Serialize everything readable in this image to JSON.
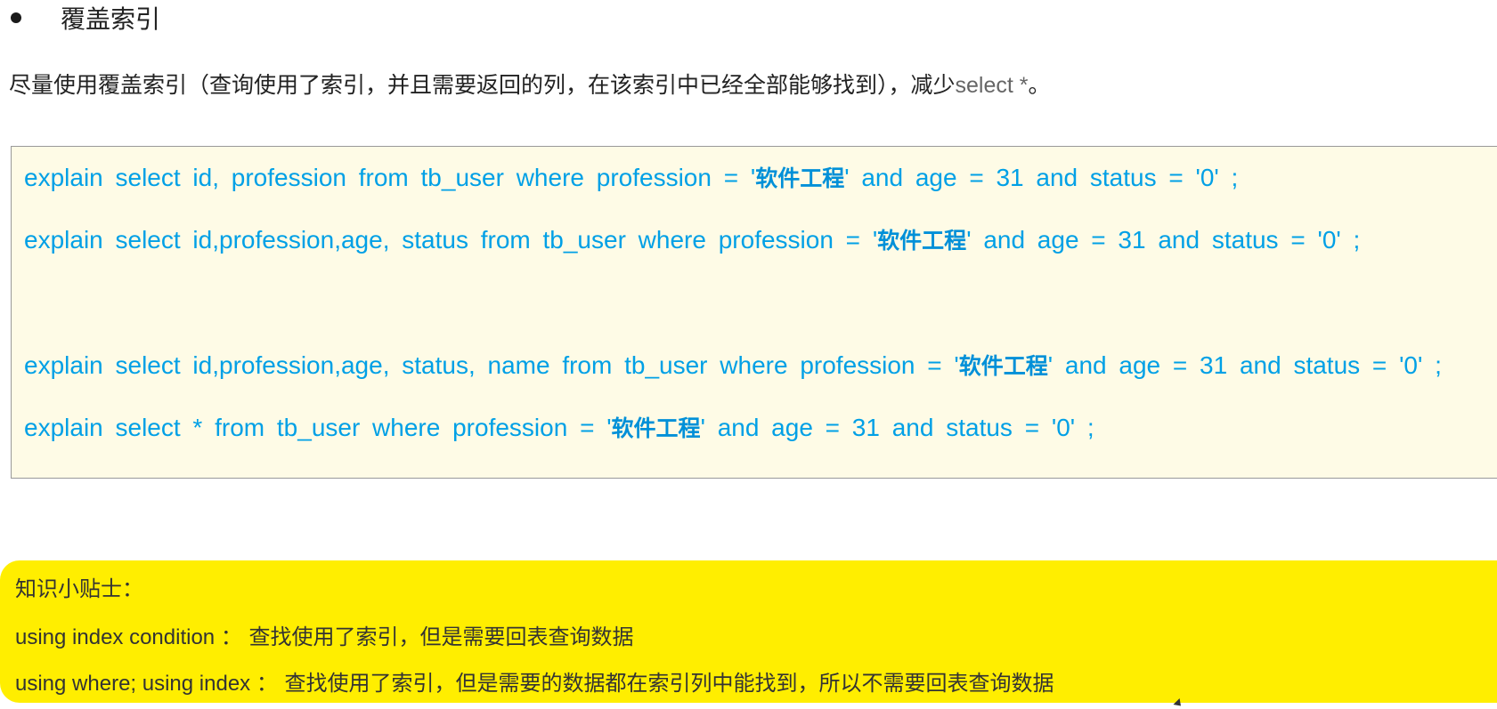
{
  "heading": {
    "title": "覆盖索引"
  },
  "intro": {
    "text": "尽量使用覆盖索引（查询使用了索引，并且需要返回的列，在该索引中已经全部能够找到），减少",
    "code": "select *",
    "end": "。"
  },
  "code_box": {
    "lines": [
      {
        "pre": "explain  select id, profession from  tb_user  where  profession = '",
        "cn": "软件工程",
        "post": "'  and  age = 31  and  status = '0' ;"
      },
      {
        "pre": "explain  select  id,profession,age, status  from  tb_user  where  profession = '",
        "cn": "软件工程",
        "post": "'  and  age = 31  and  status = '0' ;"
      },
      {
        "pre": "explain  select  id,profession,age, status, name  from  tb_user  where  profession = '",
        "cn": "软件工程",
        "post": "'  and  age = 31  and  status = '0' ;"
      },
      {
        "pre": "explain  select  *  from  tb_user  where  profession = '",
        "cn": "软件工程",
        "post": "'  and  age = 31  and  status = '0' ;"
      }
    ]
  },
  "tips": {
    "title": "知识小贴士：",
    "items": [
      {
        "term": "using index condition ：",
        "desc": "查找使用了索引，但是需要回表查询数据"
      },
      {
        "term": "using where; using index ：",
        "desc": "查找使用了索引，但是需要的数据都在索引列中能找到，所以不需要回表查询数据"
      }
    ]
  },
  "colors": {
    "code_text": "#00a0e6",
    "code_bg": "#fefbe6",
    "tip_bg": "#ffee00"
  }
}
